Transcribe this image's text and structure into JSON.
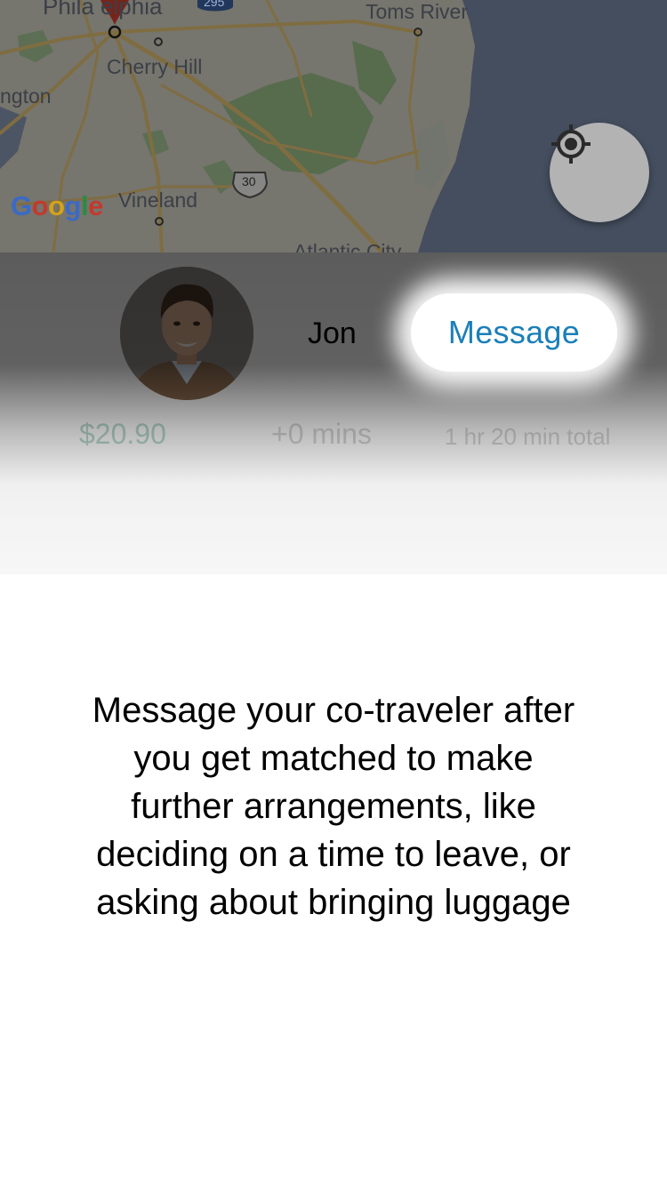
{
  "map": {
    "labels": {
      "philadelphia": "Phila elphia",
      "cherry_hill": "Cherry Hill",
      "wilmington": "ngton",
      "vineland": "Vineland",
      "toms_river": "Toms River",
      "atlantic_city": "Atlantic City",
      "route_30": "30",
      "route_295": "295"
    },
    "google_logo_letters": [
      "G",
      "o",
      "o",
      "g",
      "l",
      "e"
    ],
    "colors": {
      "land": "#d8d6c8",
      "water": "#7d8fac",
      "park": "#9fc38d",
      "road": "#e8c678",
      "overlay": "rgba(0,0,0,0.45)"
    }
  },
  "locate_button": {
    "icon": "crosshair-location-icon"
  },
  "driver": {
    "name": "Jon",
    "message_label": "Message",
    "accent": "#1a7fb8"
  },
  "trip": {
    "price": "$20.90",
    "extra_time": "+0 mins",
    "total_time": "1 hr 20 min total"
  },
  "tutorial": {
    "text": "Message your co-traveler after you get matched to make further arrangements, like deciding on a time to leave, or asking about bringing luggage"
  }
}
